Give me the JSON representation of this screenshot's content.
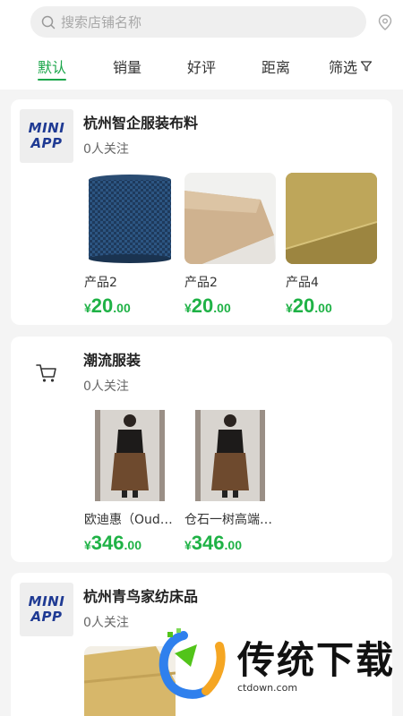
{
  "search": {
    "placeholder": "搜索店铺名称"
  },
  "tabs": [
    {
      "label": "默认",
      "active": true
    },
    {
      "label": "销量"
    },
    {
      "label": "好评"
    },
    {
      "label": "距离"
    },
    {
      "label": "筛选"
    }
  ],
  "colors": {
    "accent": "#1aa64a",
    "price": "#1fb246"
  },
  "logo_text": [
    "MINI",
    "APP"
  ],
  "shops": [
    {
      "name": "杭州智企服装布料",
      "followers": "0人关注",
      "logo": "mini-app",
      "products": [
        {
          "name": "产品2",
          "yen": "¥",
          "price_int": "20",
          "price_dec": ".00"
        },
        {
          "name": "产品2",
          "yen": "¥",
          "price_int": "20",
          "price_dec": ".00"
        },
        {
          "name": "产品4",
          "yen": "¥",
          "price_int": "20",
          "price_dec": ".00"
        }
      ]
    },
    {
      "name": "潮流服装",
      "followers": "0人关注",
      "logo": "cart-icon",
      "products": [
        {
          "name": "欧迪惠（Oud…",
          "yen": "¥",
          "price_int": "346",
          "price_dec": ".00"
        },
        {
          "name": "仓石一树高端…",
          "yen": "¥",
          "price_int": "346",
          "price_dec": ".00"
        }
      ]
    },
    {
      "name": "杭州青鸟家纺床品",
      "followers": "0人关注",
      "logo": "mini-app",
      "products": []
    }
  ],
  "watermark": {
    "title": "传统下载",
    "url": "ctdown.com"
  }
}
